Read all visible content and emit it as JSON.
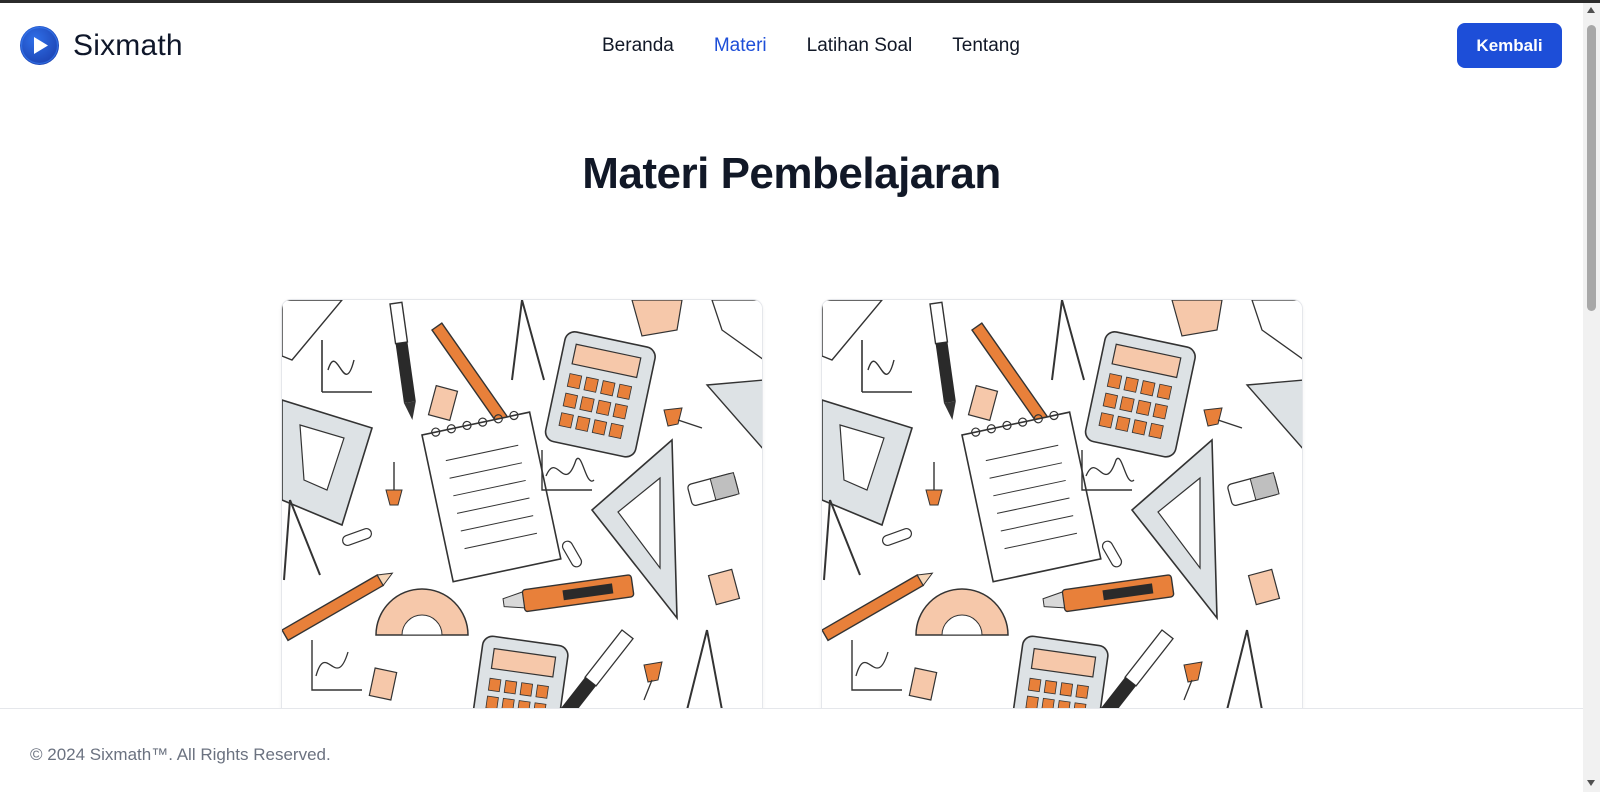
{
  "header": {
    "brand": "Sixmath",
    "nav": [
      {
        "label": "Beranda",
        "active": false
      },
      {
        "label": "Materi",
        "active": true
      },
      {
        "label": "Latihan Soal",
        "active": false
      },
      {
        "label": "Tentang",
        "active": false
      }
    ],
    "back_label": "Kembali"
  },
  "main": {
    "title": "Materi Pembelajaran",
    "cards": [
      {
        "image": "math-doodle-illustration"
      },
      {
        "image": "math-doodle-illustration"
      }
    ]
  },
  "footer": {
    "copyright": "© 2024 Sixmath™. All Rights Reserved."
  },
  "colors": {
    "accent": "#1d4ed8",
    "text": "#111827",
    "muted": "#6b7280",
    "doodle_orange": "#e8803a",
    "doodle_peach": "#f6c8aa",
    "doodle_gray": "#dde2e5"
  }
}
